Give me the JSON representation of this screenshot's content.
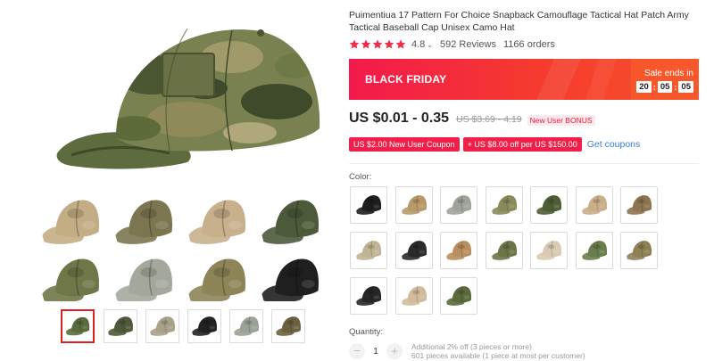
{
  "product": {
    "title": "Puimentiua 17 Pattern For Choice Snapback Camouflage Tactical Hat Patch Army Tactical Baseball Cap Unisex Camo Hat",
    "rating": "4.8",
    "reviews": "592 Reviews",
    "orders": "1166 orders"
  },
  "promo": {
    "title": "BLACK FRIDAY",
    "sale_label": "Sale ends in",
    "timer": [
      "20",
      "05",
      "05"
    ]
  },
  "pricing": {
    "price": "US $0.01 - 0.35",
    "old_price": "US $3.69 - 4.19",
    "bonus": "New User BONUS"
  },
  "coupons": {
    "items": [
      "US $2.00 New User Coupon",
      "+ US $8.00 off per US $150.00"
    ],
    "link": "Get coupons"
  },
  "options": {
    "color_label": "Color:",
    "swatches": [
      {
        "name": "black",
        "color": "#1e1e1e"
      },
      {
        "name": "tan-woodland",
        "color": "#b89a6a"
      },
      {
        "name": "acu-grey",
        "color": "#9ea39a"
      },
      {
        "name": "multicam",
        "color": "#8a8a5c"
      },
      {
        "name": "woodland-green",
        "color": "#4f5d37"
      },
      {
        "name": "desert-digital",
        "color": "#c9ae8a"
      },
      {
        "name": "brown-camo",
        "color": "#8c7451"
      },
      {
        "name": "khaki-camo",
        "color": "#c2b394"
      },
      {
        "name": "black-mesh",
        "color": "#2a2a2a"
      },
      {
        "name": "desert-tan",
        "color": "#b98f62"
      },
      {
        "name": "olive-drab",
        "color": "#6b7446"
      },
      {
        "name": "sand",
        "color": "#d8cbb2"
      },
      {
        "name": "green-digital",
        "color": "#6a7d4c"
      },
      {
        "name": "coyote-camo",
        "color": "#8f7f55"
      },
      {
        "name": "black-patch",
        "color": "#262626"
      },
      {
        "name": "light-desert",
        "color": "#d1bb9b"
      },
      {
        "name": "woodland",
        "color": "#5a6a3d"
      }
    ]
  },
  "quantity": {
    "label": "Quantity:",
    "value": "1",
    "minus": "−",
    "plus": "+",
    "info_1": "Additional 2% off (3 pieces or more)",
    "info_2": "601 pieces available (1 piece at most per customer)"
  },
  "gallery": {
    "grid_colors": [
      "#c3ad84",
      "#7c7650",
      "#c8b08c",
      "#4c5a3a",
      "#6f7748",
      "#a4a89c",
      "#8d8458",
      "#1f1f1f"
    ],
    "thumb_colors": [
      "#5b6a3d",
      "#4f5a3a",
      "#a9a08a",
      "#222222",
      "#9aa195",
      "#6b6040"
    ]
  },
  "colors": {
    "accent": "#f0204a",
    "banner_start": "#f31a4c",
    "banner_end": "#f7522a",
    "star": "#f02d47",
    "link": "#3a7bd5"
  }
}
